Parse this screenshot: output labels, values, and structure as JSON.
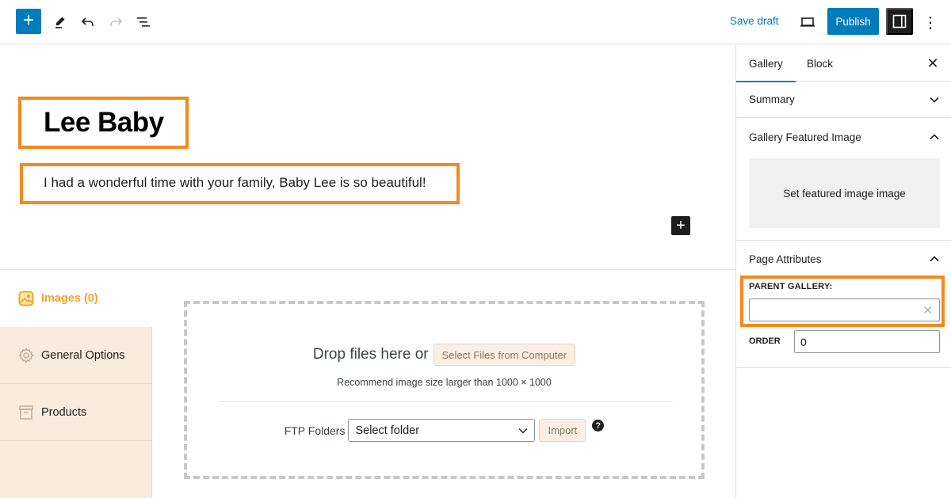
{
  "toolbar": {
    "add_block_icon": "plus-icon",
    "tools_icon": "pencil-icon",
    "undo_icon": "undo-icon",
    "redo_icon": "redo-icon",
    "list_view_icon": "list-view-icon",
    "add_glyph": "+",
    "save_draft": "Save draft",
    "preview_icon": "laptop-icon",
    "publish": "Publish",
    "settings_icon": "sidebar-toggle-icon",
    "options_glyph": "⋮",
    "accent_color": "#007cba"
  },
  "editor": {
    "title": "Lee Baby",
    "paragraph": "I had a wonderful time with your family, Baby Lee is so beautiful!",
    "block_inserter_glyph": "+",
    "highlight_color": "#f28a1e"
  },
  "metabox": {
    "tabs": [
      {
        "label": "Images (0)",
        "icon": "image-icon",
        "active": true
      },
      {
        "label": "General Options",
        "icon": "gear-icon",
        "active": false
      },
      {
        "label": "Products",
        "icon": "archive-box-icon",
        "active": false
      }
    ],
    "dropzone": {
      "drop_text": "Drop files here or",
      "select_files": "Select Files from Computer",
      "hint": "Recommend image size larger than 1000 × 1000",
      "ftp_label": "FTP Folders",
      "ftp_select_value": "Select folder",
      "import": "Import",
      "help_glyph": "?"
    }
  },
  "sidebar": {
    "tabs": [
      {
        "label": "Gallery",
        "active": true
      },
      {
        "label": "Block",
        "active": false
      }
    ],
    "close_glyph": "✕",
    "panels": {
      "summary": {
        "title": "Summary",
        "expanded": false
      },
      "featured": {
        "title": "Gallery Featured Image",
        "expanded": true,
        "button": "Set featured image image"
      },
      "page_attributes": {
        "title": "Page Attributes",
        "expanded": true,
        "parent_label": "PARENT GALLERY:",
        "parent_value": "",
        "clear_glyph": "✕",
        "order_label": "ORDER",
        "order_value": "0"
      }
    }
  }
}
